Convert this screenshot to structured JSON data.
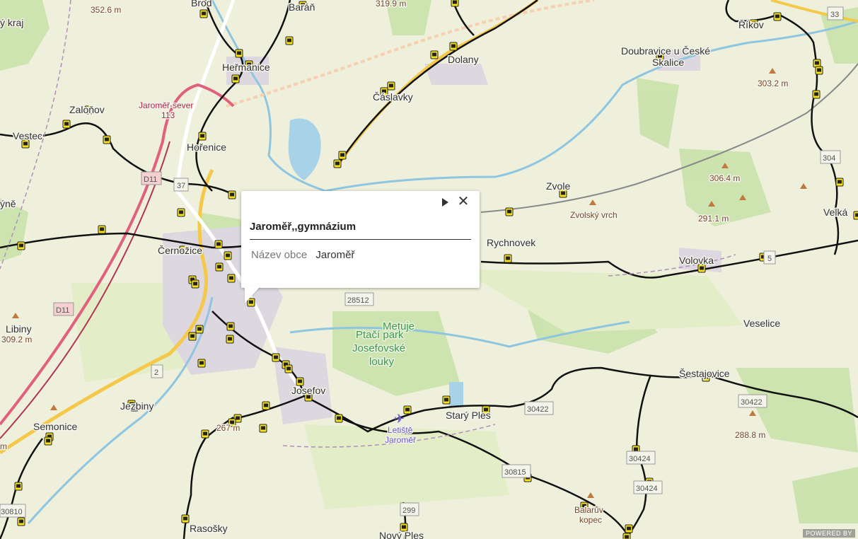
{
  "popup": {
    "title": "Jaroměř,,gymnázium",
    "field_label": "Název obce",
    "field_value": "Jaroměř",
    "next_icon": "triangle-right-icon",
    "close_symbol": "✕"
  },
  "places": {
    "brod": "Brod",
    "baran": "Baráň",
    "dolany": "Dolany",
    "heřmanice": "Heřmanice",
    "caslavky": "Čáslavky",
    "zaluzov": "Zaloňov",
    "vestec": "Vestec",
    "horenice": "Hořenice",
    "zvole": "Zvole",
    "zvolsky_vrch": "Zvolský vrch",
    "rychnovek": "Rychnovek",
    "volovka": "Volovka",
    "velka": "Velká",
    "doubravice": "Doubravice u České",
    "doubravice2": "Skalice",
    "rikov": "Říkov",
    "veselice": "Veselice",
    "sestajovice": "Šestajovice",
    "cernozice": "Černožice",
    "josefov": "Josefov",
    "jezbiny": "Jezbiny",
    "semonice": "Semonice",
    "stary_ples": "Starý Ples",
    "rasosky": "Rasošky",
    "novy_ples": "Nový Ples",
    "libiny": "Libiny",
    "balaruv": "Balarův",
    "kopec": "kopec",
    "kraj": "ý kraj",
    "vyne": "ýně",
    "m": "m"
  },
  "park": {
    "line1": "Ptačí park",
    "line2": "Josefovské",
    "line3": "louky",
    "river": "Metuje"
  },
  "airport": {
    "line1": "Letiště",
    "line2": "Jaroměř"
  },
  "station": {
    "line1": "Jaroměř-sever",
    "line2": "113"
  },
  "elevations": {
    "e1": "352.6 m",
    "e2": "319.9 m",
    "e3": "303.2 m",
    "e4": "306.4 m",
    "e5": "291.1 m",
    "e6": "309.2 m",
    "e7": "288.8 m",
    "e8": "267 m"
  },
  "roads": {
    "r33": "33",
    "r304": "304",
    "rd11a": "D11",
    "rd11b": "D11",
    "r37": "37",
    "r28512": "28512",
    "r30422a": "30422",
    "r30422b": "30422",
    "r30424a": "30424",
    "r30424b": "30424",
    "r30815": "30815",
    "r299": "299",
    "r30810": "30810",
    "r5": "5",
    "r2": "2"
  },
  "attribution": "POWERED BY",
  "colors": {
    "map_bg": "#eef0dc",
    "forest": "#c6e0a8",
    "water": "#a8d2e8",
    "urban": "#ddd8e0",
    "bus_line": "#111111",
    "bus_stop": "#f5e21a",
    "rail": "#e0607e",
    "main_road": "#f4c848"
  }
}
